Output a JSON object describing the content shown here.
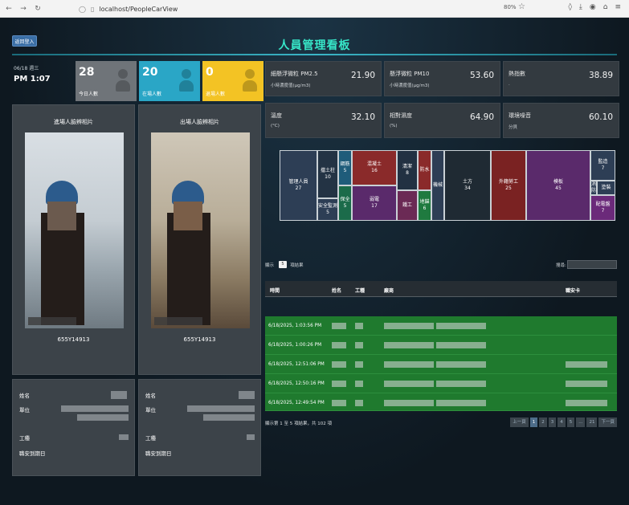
{
  "browser": {
    "url": "localhost/PeopleCarView",
    "zoom": "80%"
  },
  "header": {
    "back_label": "返回登入",
    "title": "人員管理看板"
  },
  "datetime": {
    "date": "06/18  週三",
    "time": "PM 1:07"
  },
  "stats": [
    {
      "value": "28",
      "label": "今日人數",
      "color": "#6f7479"
    },
    {
      "value": "20",
      "label": "在場人數",
      "color": "#2aa6c6"
    },
    {
      "value": "0",
      "label": "退場人數",
      "color": "#f3c324"
    }
  ],
  "sensors": [
    {
      "name": "細懸浮微粒 PM2.5",
      "unit": "小時濃度值(μg/m3)",
      "value": "21.90"
    },
    {
      "name": "懸浮微粒 PM10",
      "unit": "小時濃度值(μg/m3)",
      "value": "53.60"
    },
    {
      "name": "熱指數",
      "unit": ".",
      "value": "38.89"
    },
    {
      "name": "溫度",
      "unit": "(°C)",
      "value": "32.10"
    },
    {
      "name": "相對濕度",
      "unit": "(%)",
      "value": "64.90"
    },
    {
      "name": "環境噪音",
      "unit": "分貝",
      "value": "60.10"
    }
  ],
  "photos": {
    "entry_title": "進場人臉辨相片",
    "exit_title": "出場人臉辨相片",
    "entry_id": "655Y14913",
    "exit_id": "655Y14913"
  },
  "info_labels": {
    "name": "姓名",
    "unit": "單位",
    "trade": "工種",
    "expiry": "職安到期日"
  },
  "treemap": [
    {
      "label": "管理人員",
      "value": "27",
      "color": "#2d3e55"
    },
    {
      "label": "擋土柱",
      "value": "10",
      "color": "#233344"
    },
    {
      "label": "安全監測",
      "value": "5",
      "color": "#2d3e55"
    },
    {
      "label": "鋼筋",
      "value": "5",
      "color": "#1f5c7a"
    },
    {
      "label": "保全",
      "value": "5",
      "color": "#1b6b4a"
    },
    {
      "label": "混凝土",
      "value": "16",
      "color": "#8a2a2a"
    },
    {
      "label": "弱電",
      "value": "17",
      "color": "#5a2a6b"
    },
    {
      "label": "清潔",
      "value": "8",
      "color": "#223142"
    },
    {
      "label": "防水",
      "value": "",
      "color": "#8a2a2a"
    },
    {
      "label": "水電",
      "value": "",
      "color": "#5a2a6b"
    },
    {
      "label": "鐵工",
      "value": "",
      "color": "#6b2a55"
    },
    {
      "label": "地錨",
      "value": "6",
      "color": "#1f7a3f"
    },
    {
      "label": "機械",
      "value": "",
      "color": "#2d3e55"
    },
    {
      "label": "土方",
      "value": "34",
      "color": "#1f2a33"
    },
    {
      "label": "外籍勞工",
      "value": "25",
      "color": "#7a2222"
    },
    {
      "label": "模板",
      "value": "45",
      "color": "#5a2a6b"
    },
    {
      "label": "監造",
      "value": "7",
      "color": "#2d3e55"
    },
    {
      "label": "消防",
      "value": "",
      "color": "#2d3e55"
    },
    {
      "label": "塗裝",
      "value": "",
      "color": "#2d3e55"
    },
    {
      "label": "配電盤",
      "value": "7",
      "color": "#6b2a7a"
    }
  ],
  "table": {
    "length_prefix": "顯示",
    "length_value": "5",
    "length_suffix": "項結果",
    "search_label": "搜尋:",
    "columns": {
      "time": "時間",
      "name": "姓名",
      "trade": "工種",
      "unit": "廠商",
      "card": "職安卡"
    },
    "rows": [
      {
        "time": "6/18/2025, 1:03:56 PM"
      },
      {
        "time": "6/18/2025, 1:00:26 PM"
      },
      {
        "time": "6/18/2025, 12:51:06 PM"
      },
      {
        "time": "6/18/2025, 12:50:16 PM"
      },
      {
        "time": "6/18/2025, 12:49:54 PM"
      }
    ],
    "footer": "顯示第 1 至 5 項結果，共 102 項",
    "pager": {
      "prev": "上一頁",
      "pages": [
        "1",
        "2",
        "3",
        "4",
        "5",
        "...",
        "21"
      ],
      "next": "下一頁",
      "active": "1"
    }
  }
}
